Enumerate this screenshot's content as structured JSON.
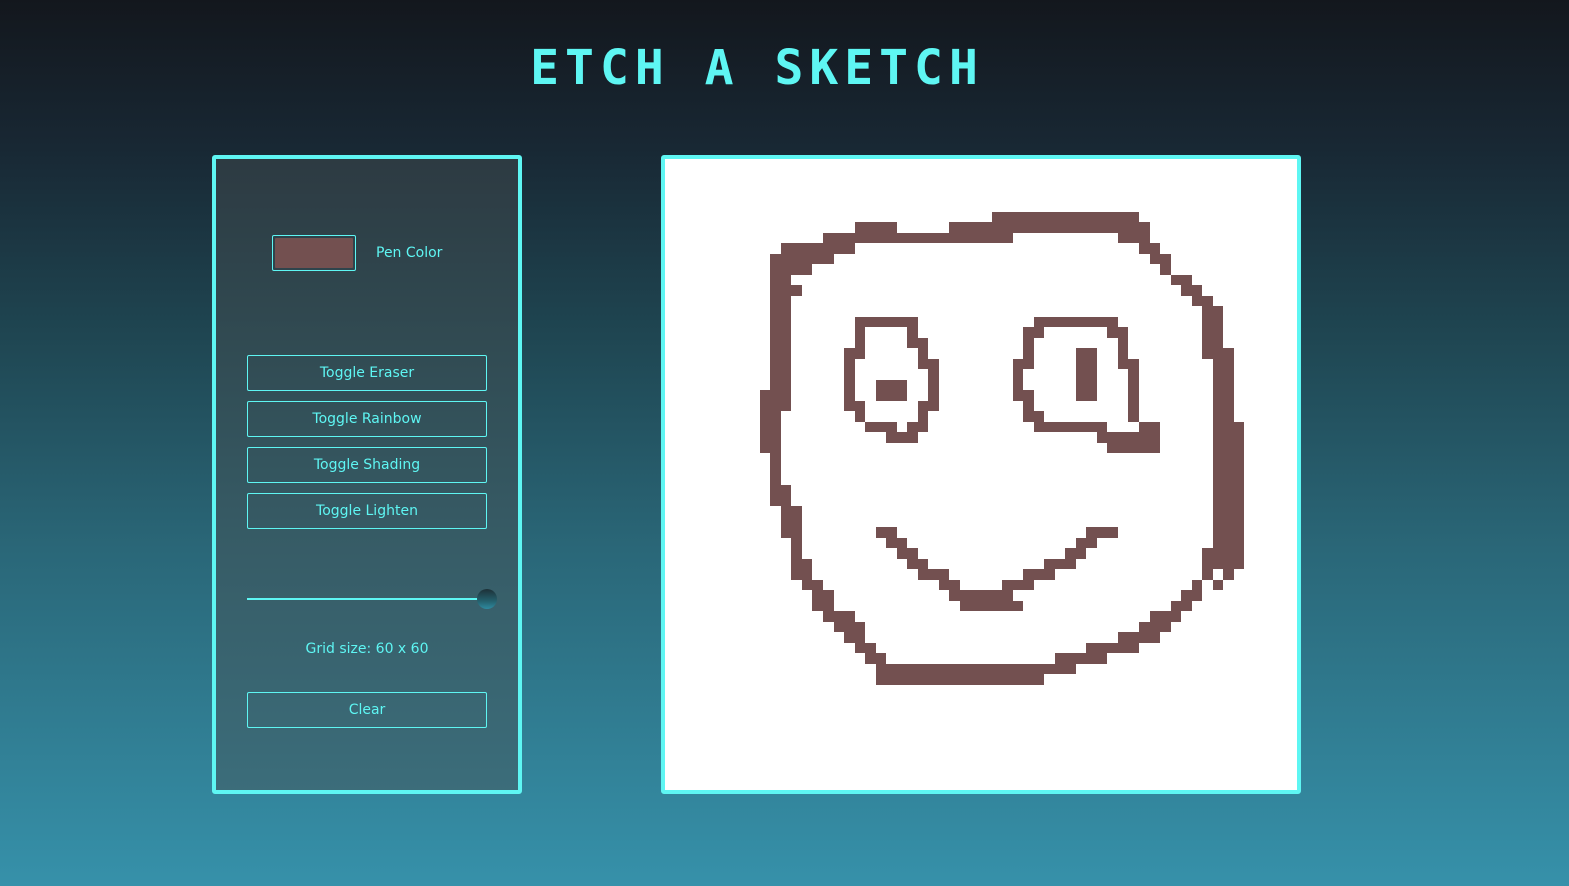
{
  "app": {
    "title": "ETCH A SKETCH"
  },
  "controls": {
    "pen_color": "#735050",
    "pen_color_label": "Pen Color",
    "buttons": {
      "eraser": "Toggle Eraser",
      "rainbow": "Toggle Rainbow",
      "shading": "Toggle Shading",
      "lighten": "Toggle Lighten",
      "clear": "Clear"
    },
    "grid_size": 60,
    "grid_size_min": 1,
    "grid_size_max": 60,
    "grid_size_label": "Grid size: 60 x 60"
  },
  "canvas": {
    "background_color": "#ffffff",
    "rows": 60,
    "cols": 60,
    "painted_runs": [
      [
        5,
        31,
        44
      ],
      [
        6,
        18,
        21
      ],
      [
        6,
        27,
        45
      ],
      [
        7,
        15,
        32
      ],
      [
        7,
        43,
        45
      ],
      [
        8,
        11,
        17
      ],
      [
        8,
        45,
        46
      ],
      [
        9,
        10,
        15
      ],
      [
        9,
        46,
        47
      ],
      [
        10,
        10,
        13
      ],
      [
        10,
        47,
        47
      ],
      [
        11,
        10,
        11
      ],
      [
        11,
        48,
        49
      ],
      [
        12,
        10,
        12
      ],
      [
        12,
        49,
        50
      ],
      [
        13,
        10,
        11
      ],
      [
        13,
        50,
        51
      ],
      [
        14,
        10,
        11
      ],
      [
        14,
        51,
        52
      ],
      [
        15,
        10,
        11
      ],
      [
        15,
        18,
        23
      ],
      [
        15,
        35,
        42
      ],
      [
        15,
        51,
        52
      ],
      [
        16,
        10,
        11
      ],
      [
        16,
        18,
        18
      ],
      [
        16,
        23,
        23
      ],
      [
        16,
        34,
        35
      ],
      [
        16,
        42,
        43
      ],
      [
        16,
        51,
        52
      ],
      [
        17,
        10,
        11
      ],
      [
        17,
        18,
        18
      ],
      [
        17,
        23,
        24
      ],
      [
        17,
        34,
        34
      ],
      [
        17,
        43,
        43
      ],
      [
        17,
        51,
        52
      ],
      [
        18,
        10,
        11
      ],
      [
        18,
        17,
        18
      ],
      [
        18,
        24,
        24
      ],
      [
        18,
        34,
        34
      ],
      [
        18,
        39,
        40
      ],
      [
        18,
        43,
        43
      ],
      [
        18,
        51,
        53
      ],
      [
        19,
        10,
        11
      ],
      [
        19,
        17,
        17
      ],
      [
        19,
        24,
        25
      ],
      [
        19,
        33,
        34
      ],
      [
        19,
        39,
        40
      ],
      [
        19,
        43,
        44
      ],
      [
        19,
        52,
        53
      ],
      [
        20,
        10,
        11
      ],
      [
        20,
        17,
        17
      ],
      [
        20,
        25,
        25
      ],
      [
        20,
        33,
        33
      ],
      [
        20,
        39,
        40
      ],
      [
        20,
        44,
        44
      ],
      [
        20,
        52,
        53
      ],
      [
        21,
        10,
        11
      ],
      [
        21,
        17,
        17
      ],
      [
        21,
        20,
        22
      ],
      [
        21,
        25,
        25
      ],
      [
        21,
        33,
        33
      ],
      [
        21,
        39,
        40
      ],
      [
        21,
        44,
        44
      ],
      [
        21,
        52,
        53
      ],
      [
        22,
        9,
        11
      ],
      [
        22,
        17,
        17
      ],
      [
        22,
        20,
        22
      ],
      [
        22,
        25,
        25
      ],
      [
        22,
        33,
        34
      ],
      [
        22,
        39,
        40
      ],
      [
        22,
        44,
        44
      ],
      [
        22,
        52,
        53
      ],
      [
        23,
        9,
        11
      ],
      [
        23,
        17,
        18
      ],
      [
        23,
        24,
        25
      ],
      [
        23,
        34,
        34
      ],
      [
        23,
        44,
        44
      ],
      [
        23,
        52,
        53
      ],
      [
        24,
        9,
        10
      ],
      [
        24,
        18,
        18
      ],
      [
        24,
        24,
        24
      ],
      [
        24,
        34,
        35
      ],
      [
        24,
        44,
        44
      ],
      [
        24,
        52,
        53
      ],
      [
        25,
        9,
        10
      ],
      [
        25,
        19,
        21
      ],
      [
        25,
        23,
        24
      ],
      [
        25,
        35,
        41
      ],
      [
        25,
        45,
        46
      ],
      [
        25,
        52,
        54
      ],
      [
        26,
        9,
        10
      ],
      [
        26,
        21,
        23
      ],
      [
        26,
        41,
        46
      ],
      [
        26,
        52,
        54
      ],
      [
        27,
        9,
        10
      ],
      [
        27,
        42,
        46
      ],
      [
        27,
        52,
        54
      ],
      [
        28,
        10,
        10
      ],
      [
        28,
        52,
        54
      ],
      [
        29,
        10,
        10
      ],
      [
        29,
        52,
        54
      ],
      [
        30,
        10,
        10
      ],
      [
        30,
        52,
        54
      ],
      [
        31,
        10,
        11
      ],
      [
        31,
        52,
        54
      ],
      [
        32,
        10,
        11
      ],
      [
        32,
        52,
        54
      ],
      [
        33,
        11,
        12
      ],
      [
        33,
        52,
        54
      ],
      [
        34,
        11,
        12
      ],
      [
        34,
        52,
        54
      ],
      [
        35,
        11,
        12
      ],
      [
        35,
        20,
        21
      ],
      [
        35,
        40,
        42
      ],
      [
        35,
        52,
        54
      ],
      [
        36,
        12,
        12
      ],
      [
        36,
        21,
        22
      ],
      [
        36,
        39,
        40
      ],
      [
        36,
        52,
        54
      ],
      [
        37,
        12,
        12
      ],
      [
        37,
        22,
        23
      ],
      [
        37,
        38,
        39
      ],
      [
        37,
        51,
        54
      ],
      [
        38,
        12,
        13
      ],
      [
        38,
        23,
        24
      ],
      [
        38,
        36,
        38
      ],
      [
        38,
        51,
        54
      ],
      [
        39,
        12,
        13
      ],
      [
        39,
        24,
        26
      ],
      [
        39,
        34,
        36
      ],
      [
        39,
        51,
        51
      ],
      [
        39,
        53,
        53
      ],
      [
        40,
        13,
        14
      ],
      [
        40,
        26,
        27
      ],
      [
        40,
        32,
        34
      ],
      [
        40,
        50,
        50
      ],
      [
        40,
        52,
        52
      ],
      [
        41,
        14,
        15
      ],
      [
        41,
        27,
        29
      ],
      [
        41,
        30,
        32
      ],
      [
        41,
        49,
        50
      ],
      [
        42,
        14,
        15
      ],
      [
        42,
        28,
        33
      ],
      [
        42,
        48,
        49
      ],
      [
        43,
        15,
        17
      ],
      [
        43,
        46,
        48
      ],
      [
        44,
        16,
        18
      ],
      [
        44,
        45,
        47
      ],
      [
        45,
        17,
        18
      ],
      [
        45,
        43,
        46
      ],
      [
        46,
        18,
        19
      ],
      [
        46,
        40,
        44
      ],
      [
        47,
        19,
        20
      ],
      [
        47,
        37,
        41
      ],
      [
        48,
        20,
        38
      ],
      [
        49,
        20,
        35
      ]
    ]
  }
}
